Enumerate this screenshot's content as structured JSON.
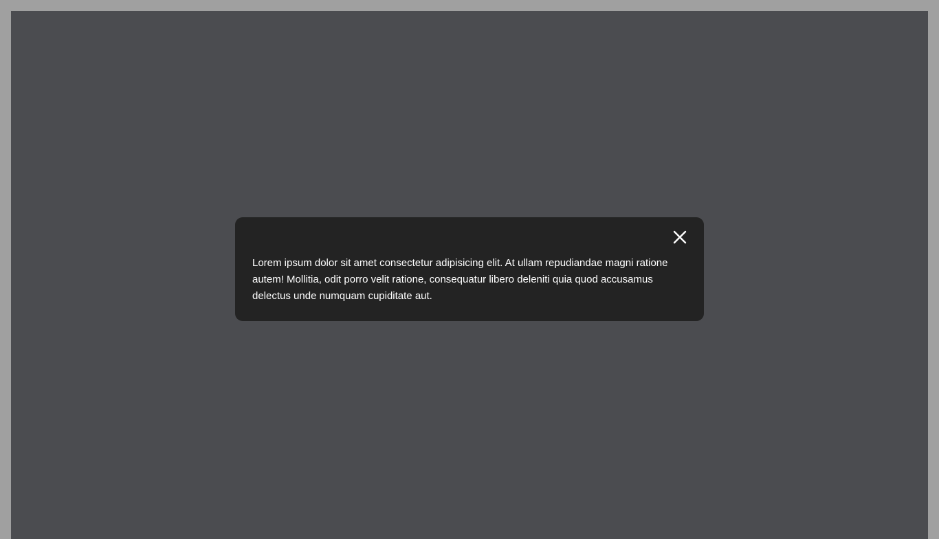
{
  "modal": {
    "close_icon": "close-icon",
    "body_text": "Lorem ipsum dolor sit amet consectetur adipisicing elit. At ullam repudiandae magni ratione autem! Mollitia, odit porro velit ratione, consequatur libero deleniti quia quod accusamus delectus unde numquam cupiditate aut."
  },
  "colors": {
    "page_frame": "#a0a0a0",
    "overlay": "#4b4c50",
    "modal_background": "#232323",
    "text": "#ffffff"
  }
}
